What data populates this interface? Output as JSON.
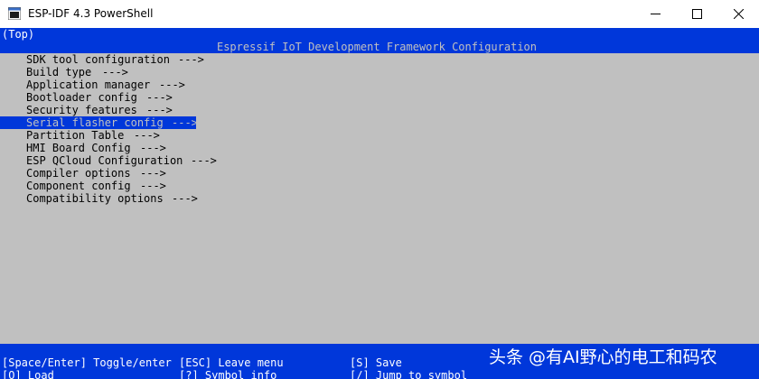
{
  "window": {
    "title": "ESP-IDF 4.3 PowerShell",
    "icon": "powershell-icon"
  },
  "terminal": {
    "breadcrumb": "(Top)",
    "header_title": "Espressif IoT Development Framework Configuration",
    "menu_items": [
      {
        "label": "SDK tool configuration",
        "arrow": "--->",
        "selected": false
      },
      {
        "label": "Build type",
        "arrow": "--->",
        "selected": false
      },
      {
        "label": "Application manager",
        "arrow": "--->",
        "selected": false
      },
      {
        "label": "Bootloader config",
        "arrow": "--->",
        "selected": false
      },
      {
        "label": "Security features",
        "arrow": "--->",
        "selected": false
      },
      {
        "label": "Serial flasher config",
        "arrow": "--->",
        "selected": true
      },
      {
        "label": "Partition Table",
        "arrow": "--->",
        "selected": false
      },
      {
        "label": "HMI Board Config",
        "arrow": "--->",
        "selected": false
      },
      {
        "label": "ESP QCloud Configuration",
        "arrow": "--->",
        "selected": false
      },
      {
        "label": "Compiler options",
        "arrow": "--->",
        "selected": false
      },
      {
        "label": "Component config",
        "arrow": "--->",
        "selected": false
      },
      {
        "label": "Compatibility options",
        "arrow": "--->",
        "selected": false
      }
    ],
    "key_hints": {
      "row1": [
        "[Space/Enter] Toggle/enter",
        "[ESC] Leave menu",
        "[S] Save"
      ],
      "row2": [
        "[O] Load",
        "[?] Symbol info",
        "[/] Jump to symbol"
      ]
    }
  },
  "watermark": "头条 @有AI野心的电工和码农",
  "colors": {
    "terminal_bg": "#c0c0c0",
    "highlight_blue": "#0037da",
    "text_black": "#000000",
    "text_white": "#ffffff"
  }
}
